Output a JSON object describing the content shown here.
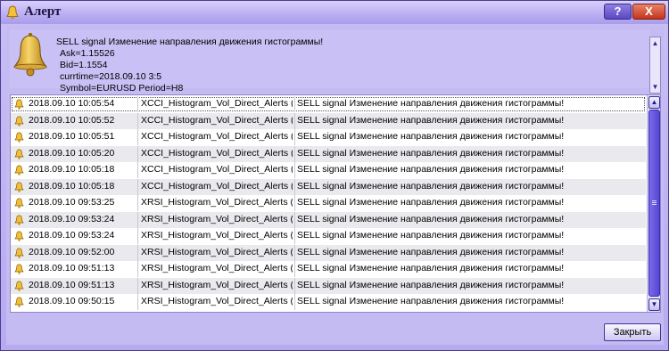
{
  "window": {
    "title": "Алерт",
    "help_label": "?",
    "close_label": "X"
  },
  "message": {
    "lines": [
      "SELL signal Изменение направления движения гистограммы!",
      "Ask=1.15526",
      "Bid=1.1554",
      "currtime=2018.09.10 3:5",
      "Symbol=EURUSD Period=H8"
    ]
  },
  "alerts": [
    {
      "time": "2018.09.10 10:05:54",
      "expert": "XCCI_Histogram_Vol_Direct_Alerts (EU...",
      "message": "SELL signal Изменение направления движения гистограммы!"
    },
    {
      "time": "2018.09.10 10:05:52",
      "expert": "XCCI_Histogram_Vol_Direct_Alerts (EU...",
      "message": "SELL signal Изменение направления движения гистограммы!"
    },
    {
      "time": "2018.09.10 10:05:51",
      "expert": "XCCI_Histogram_Vol_Direct_Alerts (EU...",
      "message": "SELL signal Изменение направления движения гистограммы!"
    },
    {
      "time": "2018.09.10 10:05:20",
      "expert": "XCCI_Histogram_Vol_Direct_Alerts (EU...",
      "message": "SELL signal Изменение направления движения гистограммы!"
    },
    {
      "time": "2018.09.10 10:05:18",
      "expert": "XCCI_Histogram_Vol_Direct_Alerts (EU...",
      "message": "SELL signal Изменение направления движения гистограммы!"
    },
    {
      "time": "2018.09.10 10:05:18",
      "expert": "XCCI_Histogram_Vol_Direct_Alerts (EU...",
      "message": "SELL signal Изменение направления движения гистограммы!"
    },
    {
      "time": "2018.09.10 09:53:25",
      "expert": "XRSI_Histogram_Vol_Direct_Alerts (EU...",
      "message": "SELL signal Изменение направления движения гистограммы!"
    },
    {
      "time": "2018.09.10 09:53:24",
      "expert": "XRSI_Histogram_Vol_Direct_Alerts (EU...",
      "message": "SELL signal Изменение направления движения гистограммы!"
    },
    {
      "time": "2018.09.10 09:53:24",
      "expert": "XRSI_Histogram_Vol_Direct_Alerts (EU...",
      "message": "SELL signal Изменение направления движения гистограммы!"
    },
    {
      "time": "2018.09.10 09:52:00",
      "expert": "XRSI_Histogram_Vol_Direct_Alerts (EU...",
      "message": "SELL signal Изменение направления движения гистограммы!"
    },
    {
      "time": "2018.09.10 09:51:13",
      "expert": "XRSI_Histogram_Vol_Direct_Alerts (EU...",
      "message": "SELL signal Изменение направления движения гистограммы!"
    },
    {
      "time": "2018.09.10 09:51:13",
      "expert": "XRSI_Histogram_Vol_Direct_Alerts (EU...",
      "message": "SELL signal Изменение направления движения гистограммы!"
    },
    {
      "time": "2018.09.10 09:50:15",
      "expert": "XRSI_Histogram_Vol_Direct_Alerts (EU...",
      "message": "SELL signal Изменение направления движения гистограммы!"
    }
  ],
  "buttons": {
    "close": "Закрыть"
  },
  "icons": {
    "title": "bell-icon",
    "message": "bell-icon",
    "row": "bell-icon"
  },
  "colors": {
    "titlebar": "#bdb0f3",
    "window_bg": "#c5bbf3",
    "alt_row": "#e9e9ee",
    "scroll_thumb": "#5a4bd6"
  }
}
